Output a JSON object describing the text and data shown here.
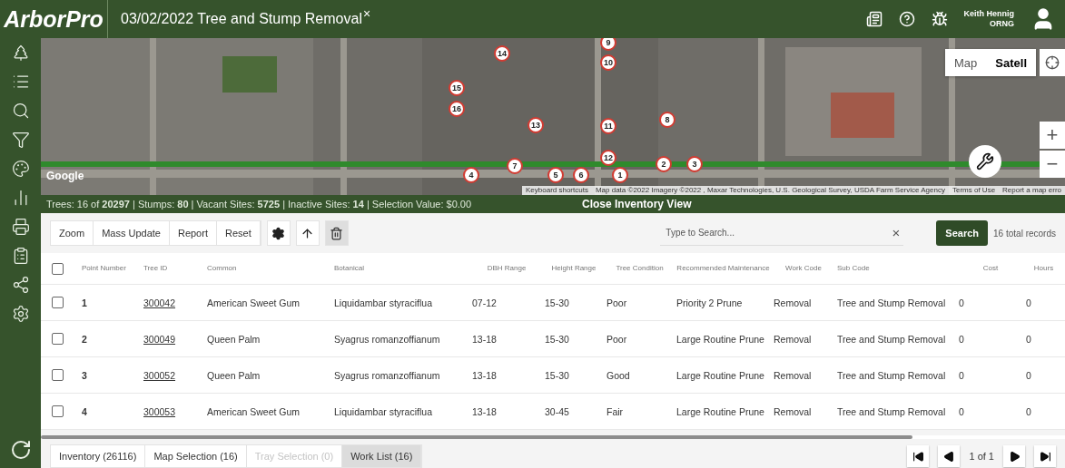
{
  "header": {
    "logo": "ArborPro",
    "title": "03/02/2022 Tree and Stump Removal",
    "close": "×",
    "user": {
      "name": "Keith Hennig",
      "org": "ORNG"
    }
  },
  "map": {
    "kind": "picture",
    "type_buttons": [
      {
        "label": "Map",
        "selected": false
      },
      {
        "label": "Satell",
        "selected": true
      }
    ],
    "zoom_in": "+",
    "zoom_out": "−",
    "google": "Google",
    "attribution": [
      "Keyboard shortcuts",
      "Map data ©2022 Imagery ©2022 , Maxar Technologies, U.S. Geological Survey, USDA Farm Service Agency",
      "Terms of Use",
      "Report a map erro"
    ],
    "markers": [
      "9",
      "14",
      "10",
      "15",
      "16",
      "8",
      "13",
      "11",
      "12",
      "7",
      "4",
      "5",
      "6",
      "1",
      "2",
      "3"
    ]
  },
  "stats": "Trees: 16 of **20297** | Stumps: **80** | Vacant Sites: **5725** | Inactive Sites: **14** | Selection Value: $0.00",
  "close_view": "Close Inventory View",
  "toolbar": {
    "buttons": [
      "Zoom",
      "Mass Update",
      "Report",
      "Reset"
    ],
    "search_placeholder": "Type to Search...",
    "clear": "×",
    "search": "Search",
    "total": "16 total records"
  },
  "table": {
    "select_all_checked": false,
    "columns": [
      "Point Number",
      "Tree ID",
      "Common",
      "Botanical",
      "DBH Range",
      "Height Range",
      "Tree Condition",
      "Recommended Maintenance",
      "Work Code",
      "Sub Code",
      "Cost",
      "Hours"
    ],
    "rows": [
      {
        "checked": false,
        "cells": [
          "1",
          "300042",
          "American Sweet Gum",
          "Liquidambar styraciflua",
          "07-12",
          "15-30",
          "Poor",
          "Priority 2 Prune",
          "Removal",
          "Tree and Stump Removal",
          "0",
          "0"
        ]
      },
      {
        "checked": false,
        "cells": [
          "2",
          "300049",
          "Queen Palm",
          "Syagrus romanzoffianum",
          "13-18",
          "15-30",
          "Poor",
          "Large Routine Prune",
          "Removal",
          "Tree and Stump Removal",
          "0",
          "0"
        ]
      },
      {
        "checked": false,
        "cells": [
          "3",
          "300052",
          "Queen Palm",
          "Syagrus romanzoffianum",
          "13-18",
          "15-30",
          "Good",
          "Large Routine Prune",
          "Removal",
          "Tree and Stump Removal",
          "0",
          "0"
        ]
      },
      {
        "checked": false,
        "cells": [
          "4",
          "300053",
          "American Sweet Gum",
          "Liquidambar styraciflua",
          "13-18",
          "30-45",
          "Fair",
          "Large Routine Prune",
          "Removal",
          "Tree and Stump Removal",
          "0",
          "0"
        ]
      }
    ]
  },
  "bottom_tabs": [
    {
      "label": "Inventory (26116)",
      "selected": false,
      "disabled": false
    },
    {
      "label": "Map Selection (16)",
      "selected": false,
      "disabled": false
    },
    {
      "label": "Tray Selection (0)",
      "selected": false,
      "disabled": true
    },
    {
      "label": "Work List (16)",
      "selected": true,
      "disabled": false
    }
  ],
  "pager": "1 of 1"
}
